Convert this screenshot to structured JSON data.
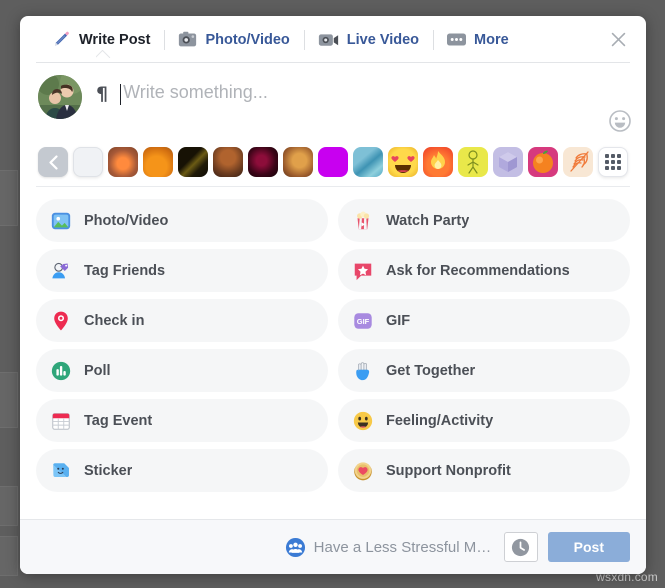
{
  "watermark": "wsxdn.com",
  "dialog": {
    "tabs": [
      {
        "label": "Write Post",
        "icon": "pencil-icon",
        "active": true
      },
      {
        "label": "Photo/Video",
        "icon": "camera-icon",
        "active": false
      },
      {
        "label": "Live Video",
        "icon": "video-camera-icon",
        "active": false
      },
      {
        "label": "More",
        "icon": "ellipsis-icon",
        "active": false
      }
    ],
    "close_label": "Close",
    "composer": {
      "avatar_alt": "user-profile-photo",
      "paragraph_mark": "¶",
      "placeholder": "Write something...",
      "emoji_button": "emoji-picker"
    },
    "backgrounds": {
      "prev_label": "‹",
      "grid_label": "more-backgrounds",
      "swatches": [
        {
          "name": "no-background",
          "kind": "plain"
        },
        {
          "name": "autumn-leaf",
          "kind": "image",
          "color": "#c07a52"
        },
        {
          "name": "pumpkin",
          "kind": "image",
          "color": "#e08a2b"
        },
        {
          "name": "dark-leaf",
          "kind": "image",
          "color": "#2a2416"
        },
        {
          "name": "acorns",
          "kind": "image",
          "color": "#5a3a24"
        },
        {
          "name": "dark-red",
          "kind": "image",
          "color": "#2c0913"
        },
        {
          "name": "golden-leaf",
          "kind": "image",
          "color": "#b06a32"
        },
        {
          "name": "magenta",
          "kind": "solid",
          "color": "#c800f0"
        },
        {
          "name": "blue-abstract",
          "kind": "image",
          "color": "#6aaec8"
        },
        {
          "name": "heart-eyes-emoji",
          "kind": "image",
          "color": "#f2d04b"
        },
        {
          "name": "fire-emoji",
          "kind": "image",
          "color": "#f2622e"
        },
        {
          "name": "yellow-doodle",
          "kind": "image",
          "color": "#e9e84a"
        },
        {
          "name": "lavender-cube",
          "kind": "image",
          "color": "#b3aede"
        },
        {
          "name": "orange-fruit",
          "kind": "image",
          "color": "#d63a7e"
        },
        {
          "name": "palm-leaf",
          "kind": "image",
          "color": "#f6e4cf"
        }
      ]
    },
    "options": [
      {
        "label": "Photo/Video",
        "icon": "photo-video-icon"
      },
      {
        "label": "Watch Party",
        "icon": "popcorn-icon"
      },
      {
        "label": "Tag Friends",
        "icon": "tag-friends-icon"
      },
      {
        "label": "Ask for Recommendations",
        "icon": "recommendations-icon"
      },
      {
        "label": "Check in",
        "icon": "location-pin-icon"
      },
      {
        "label": "GIF",
        "icon": "gif-icon"
      },
      {
        "label": "Poll",
        "icon": "poll-icon"
      },
      {
        "label": "Get Together",
        "icon": "waving-hand-icon"
      },
      {
        "label": "Tag Event",
        "icon": "calendar-icon"
      },
      {
        "label": "Feeling/Activity",
        "icon": "smiley-icon"
      },
      {
        "label": "Sticker",
        "icon": "sticker-icon"
      },
      {
        "label": "Support Nonprofit",
        "icon": "heart-coin-icon"
      }
    ],
    "footer": {
      "audience_label": "Have a Less Stressful Marri...",
      "audience_icon": "group-icon",
      "schedule_icon": "clock-icon",
      "post_label": "Post",
      "post_color": "#8badd9"
    }
  }
}
